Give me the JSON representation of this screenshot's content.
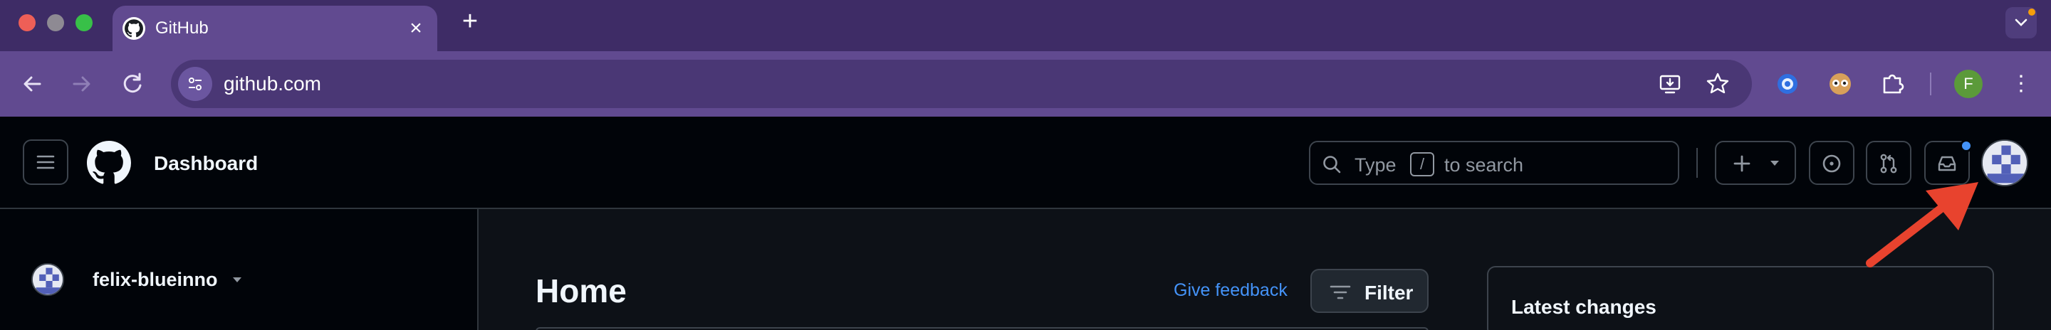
{
  "browser": {
    "tab": {
      "title": "GitHub",
      "favicon": "github-icon"
    },
    "url": "github.com",
    "profile_initial": "F",
    "colors": {
      "tabstrip": "#3e2c66",
      "toolbar": "#614a90",
      "omnibox": "#4a3775"
    }
  },
  "header": {
    "context_title": "Dashboard",
    "search": {
      "prefix": "Type",
      "key": "/",
      "suffix": "to search"
    },
    "buttons": [
      "create-new",
      "issues",
      "pull-requests",
      "inbox",
      "user-avatar"
    ]
  },
  "sidebar": {
    "user": {
      "name": "felix-blueinno"
    }
  },
  "main": {
    "title": "Home",
    "feedback_link": "Give feedback",
    "filter_label": "Filter"
  },
  "right_column": {
    "latest_changes_title": "Latest changes"
  },
  "annotation": {
    "type": "red-arrow",
    "target": "user-avatar",
    "color": "#e8432e"
  }
}
